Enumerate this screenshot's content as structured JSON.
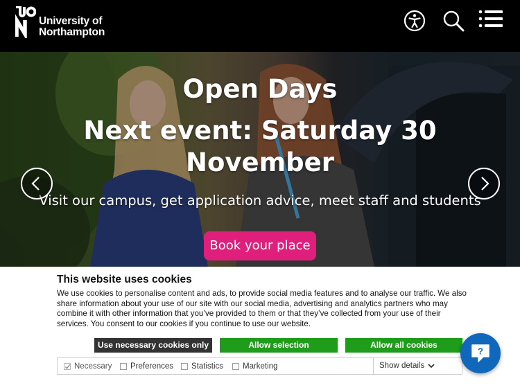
{
  "header": {
    "logo_mark": "UON",
    "logo_line1": "University of",
    "logo_line2": "Northampton",
    "icons": [
      "accessibility-icon",
      "search-icon",
      "menu-icon"
    ]
  },
  "hero": {
    "title": "Open Days",
    "subtitle": "Next event: Saturday 30 November",
    "description": "Visit our campus, get application advice, meet staff and students",
    "cta_label": "Book your place",
    "cta_color": "#e01f7d",
    "prev_icon": "chevron-left-icon",
    "next_icon": "chevron-right-icon"
  },
  "cookie_banner": {
    "title": "This website uses cookies",
    "text": "We use cookies to personalise content and ads, to provide social media features and to analyse our traffic. We also share information about your use of our site with our social media, advertising and analytics partners who may combine it with other information that you’ve provided to them or that they’ve collected from your use of their services. You consent to our cookies if you continue to use our website.",
    "buttons": {
      "necessary_only": "Use necessary cookies only",
      "allow_selection": "Allow selection",
      "allow_all": "Allow all cookies"
    },
    "options": [
      {
        "label": "Necessary",
        "checked": true,
        "disabled": true
      },
      {
        "label": "Preferences",
        "checked": false
      },
      {
        "label": "Statistics",
        "checked": false
      },
      {
        "label": "Marketing",
        "checked": false
      }
    ],
    "show_details": "Show details",
    "colors": {
      "dark_button": "#333333",
      "green_button": "#1e9c1a"
    }
  },
  "help": {
    "icon": "help-chat-icon",
    "color": "#1167b9"
  }
}
